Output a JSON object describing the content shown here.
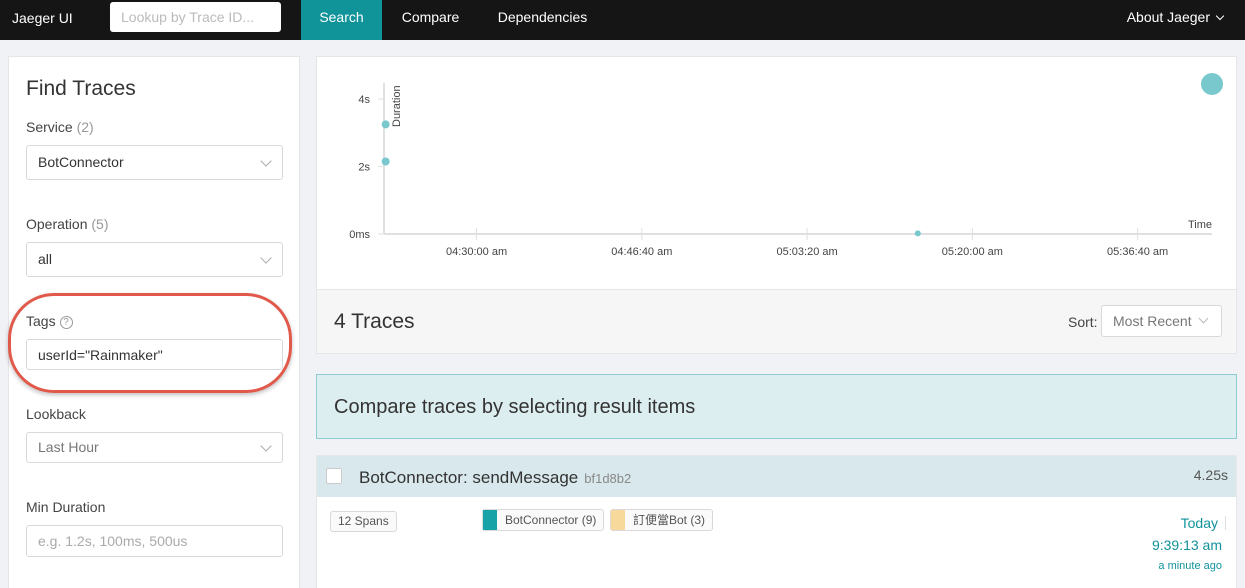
{
  "nav": {
    "brand": "Jaeger UI",
    "lookup_placeholder": "Lookup by Trace ID...",
    "tabs": [
      {
        "label": "Search",
        "active": true
      },
      {
        "label": "Compare",
        "active": false
      },
      {
        "label": "Dependencies",
        "active": false
      }
    ],
    "about_label": "About Jaeger"
  },
  "find_traces": {
    "title": "Find Traces",
    "service": {
      "label": "Service",
      "count": "(2)",
      "value": "BotConnector"
    },
    "operation": {
      "label": "Operation",
      "count": "(5)",
      "value": "all"
    },
    "tags": {
      "label": "Tags",
      "help_glyph": "?",
      "value": "userId=\"Rainmaker\""
    },
    "lookback": {
      "label": "Lookback",
      "value": "Last Hour"
    },
    "min_duration": {
      "label": "Min Duration",
      "placeholder": "e.g. 1.2s, 100ms, 500us"
    }
  },
  "chart_data": {
    "type": "scatter",
    "ylabel": "Duration",
    "xlabel": "Time",
    "y_ticks": [
      "4s",
      "2s",
      "0ms"
    ],
    "y_tick_values": [
      4,
      2,
      0
    ],
    "ylim": [
      0,
      4.3
    ],
    "x_ticks": [
      "04:30:00 am",
      "04:46:40 am",
      "05:03:20 am",
      "05:20:00 am",
      "05:36:40 am"
    ],
    "x_tick_values": [
      1,
      2,
      3,
      4,
      5
    ],
    "xlim": [
      0.44,
      5.45
    ],
    "points": [
      {
        "x": 0.45,
        "y": 3.25
      },
      {
        "x": 0.45,
        "y": 2.15
      },
      {
        "x": 3.67,
        "y": 0.02
      }
    ],
    "marker_color": "#78c8ce"
  },
  "results_header": {
    "count_label": "4 Traces",
    "sort_label": "Sort:",
    "sort_value": "Most Recent"
  },
  "compare_banner": "Compare traces by selecting result items",
  "result": {
    "service_op": "BotConnector: sendMessage",
    "trace_id": "bf1d8b2",
    "duration": "4.25s",
    "spans": "12 Spans",
    "services": [
      {
        "name": "BotConnector (9)",
        "color": "#17a2a8"
      },
      {
        "name": "訂便當Bot (3)",
        "color": "#f7d99b"
      }
    ],
    "day": "Today",
    "time": "9:39:13 am",
    "ago": "a minute ago"
  },
  "colors": {
    "accent": "#11939a",
    "highlight_ring": "#e0594b"
  }
}
